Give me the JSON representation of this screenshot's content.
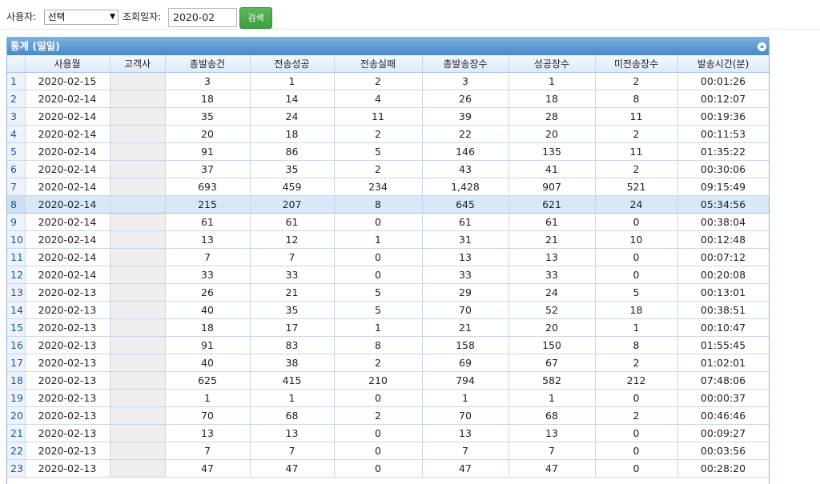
{
  "toolbar": {
    "user_label": "사용자:",
    "user_select_value": "선택",
    "date_label": "조회일자:",
    "date_value": "2020-02",
    "search_label": "검색"
  },
  "panel": {
    "title": "통계 (일일)",
    "collapse_glyph": "▴"
  },
  "columns": [
    "사용월",
    "고객사",
    "총발송건",
    "전송성공",
    "전송실패",
    "총발송장수",
    "성공장수",
    "미전송장수",
    "발송시간(분)"
  ],
  "selected_row": 8,
  "rows": [
    {
      "n": "1",
      "month": "2020-02-15",
      "cust": "",
      "total": "3",
      "ok": "1",
      "fail": "2",
      "pages": "3",
      "okp": "1",
      "unsent": "2",
      "time": "00:01:26"
    },
    {
      "n": "2",
      "month": "2020-02-14",
      "cust": "",
      "total": "18",
      "ok": "14",
      "fail": "4",
      "pages": "26",
      "okp": "18",
      "unsent": "8",
      "time": "00:12:07"
    },
    {
      "n": "3",
      "month": "2020-02-14",
      "cust": "",
      "total": "35",
      "ok": "24",
      "fail": "11",
      "pages": "39",
      "okp": "28",
      "unsent": "11",
      "time": "00:19:36"
    },
    {
      "n": "4",
      "month": "2020-02-14",
      "cust": "",
      "total": "20",
      "ok": "18",
      "fail": "2",
      "pages": "22",
      "okp": "20",
      "unsent": "2",
      "time": "00:11:53"
    },
    {
      "n": "5",
      "month": "2020-02-14",
      "cust": "",
      "total": "91",
      "ok": "86",
      "fail": "5",
      "pages": "146",
      "okp": "135",
      "unsent": "11",
      "time": "01:35:22"
    },
    {
      "n": "6",
      "month": "2020-02-14",
      "cust": "",
      "total": "37",
      "ok": "35",
      "fail": "2",
      "pages": "43",
      "okp": "41",
      "unsent": "2",
      "time": "00:30:06"
    },
    {
      "n": "7",
      "month": "2020-02-14",
      "cust": "",
      "total": "693",
      "ok": "459",
      "fail": "234",
      "pages": "1,428",
      "okp": "907",
      "unsent": "521",
      "time": "09:15:49"
    },
    {
      "n": "8",
      "month": "2020-02-14",
      "cust": "",
      "total": "215",
      "ok": "207",
      "fail": "8",
      "pages": "645",
      "okp": "621",
      "unsent": "24",
      "time": "05:34:56"
    },
    {
      "n": "9",
      "month": "2020-02-14",
      "cust": "",
      "total": "61",
      "ok": "61",
      "fail": "0",
      "pages": "61",
      "okp": "61",
      "unsent": "0",
      "time": "00:38:04"
    },
    {
      "n": "10",
      "month": "2020-02-14",
      "cust": "",
      "total": "13",
      "ok": "12",
      "fail": "1",
      "pages": "31",
      "okp": "21",
      "unsent": "10",
      "time": "00:12:48"
    },
    {
      "n": "11",
      "month": "2020-02-14",
      "cust": "",
      "total": "7",
      "ok": "7",
      "fail": "0",
      "pages": "13",
      "okp": "13",
      "unsent": "0",
      "time": "00:07:12"
    },
    {
      "n": "12",
      "month": "2020-02-14",
      "cust": "",
      "total": "33",
      "ok": "33",
      "fail": "0",
      "pages": "33",
      "okp": "33",
      "unsent": "0",
      "time": "00:20:08"
    },
    {
      "n": "13",
      "month": "2020-02-13",
      "cust": "",
      "total": "26",
      "ok": "21",
      "fail": "5",
      "pages": "29",
      "okp": "24",
      "unsent": "5",
      "time": "00:13:01"
    },
    {
      "n": "14",
      "month": "2020-02-13",
      "cust": "",
      "total": "40",
      "ok": "35",
      "fail": "5",
      "pages": "70",
      "okp": "52",
      "unsent": "18",
      "time": "00:38:51"
    },
    {
      "n": "15",
      "month": "2020-02-13",
      "cust": "",
      "total": "18",
      "ok": "17",
      "fail": "1",
      "pages": "21",
      "okp": "20",
      "unsent": "1",
      "time": "00:10:47"
    },
    {
      "n": "16",
      "month": "2020-02-13",
      "cust": "",
      "total": "91",
      "ok": "83",
      "fail": "8",
      "pages": "158",
      "okp": "150",
      "unsent": "8",
      "time": "01:55:45"
    },
    {
      "n": "17",
      "month": "2020-02-13",
      "cust": "",
      "total": "40",
      "ok": "38",
      "fail": "2",
      "pages": "69",
      "okp": "67",
      "unsent": "2",
      "time": "01:02:01"
    },
    {
      "n": "18",
      "month": "2020-02-13",
      "cust": "",
      "total": "625",
      "ok": "415",
      "fail": "210",
      "pages": "794",
      "okp": "582",
      "unsent": "212",
      "time": "07:48:06"
    },
    {
      "n": "19",
      "month": "2020-02-13",
      "cust": "",
      "total": "1",
      "ok": "1",
      "fail": "0",
      "pages": "1",
      "okp": "1",
      "unsent": "0",
      "time": "00:00:37"
    },
    {
      "n": "20",
      "month": "2020-02-13",
      "cust": "",
      "total": "70",
      "ok": "68",
      "fail": "2",
      "pages": "70",
      "okp": "68",
      "unsent": "2",
      "time": "00:46:46"
    },
    {
      "n": "21",
      "month": "2020-02-13",
      "cust": "",
      "total": "13",
      "ok": "13",
      "fail": "0",
      "pages": "13",
      "okp": "13",
      "unsent": "0",
      "time": "00:09:27"
    },
    {
      "n": "22",
      "month": "2020-02-13",
      "cust": "",
      "total": "7",
      "ok": "7",
      "fail": "0",
      "pages": "7",
      "okp": "7",
      "unsent": "0",
      "time": "00:03:56"
    },
    {
      "n": "23",
      "month": "2020-02-13",
      "cust": "",
      "total": "47",
      "ok": "47",
      "fail": "0",
      "pages": "47",
      "okp": "47",
      "unsent": "0",
      "time": "00:28:20"
    }
  ]
}
